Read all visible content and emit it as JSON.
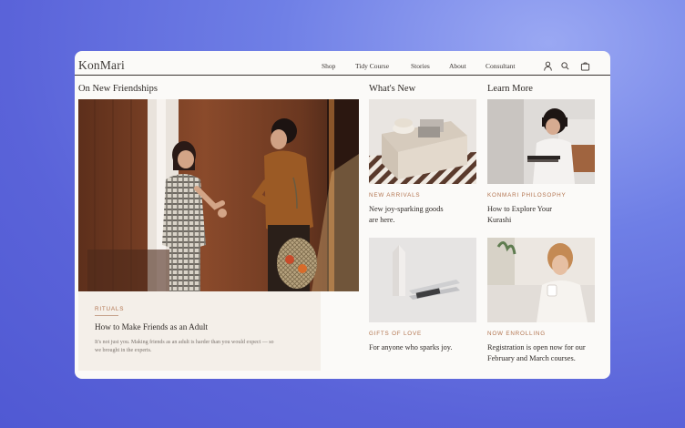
{
  "brand": {
    "logo": "KonMari"
  },
  "nav": {
    "items": [
      "Shop",
      "Tidy Course",
      "Stories",
      "About",
      "Consultant"
    ],
    "icons": [
      "account-icon",
      "search-icon",
      "cart-icon"
    ]
  },
  "featured": {
    "section_title": "On New Friendships",
    "eyebrow": "RITUALS",
    "headline": "How to Make Friends as an Adult",
    "excerpt_line1": "It's not just you. Making friends as an adult is harder than you would expect — so",
    "excerpt_line2": "we brought in the experts."
  },
  "whats_new": {
    "section_title": "What's New",
    "cards": [
      {
        "eyebrow": "NEW ARRIVALS",
        "text_line1": "New joy-sparking goods",
        "text_line2": "are here."
      },
      {
        "eyebrow": "GIFTS OF LOVE",
        "text_line1": "For anyone who sparks joy.",
        "text_line2": ""
      }
    ]
  },
  "learn_more": {
    "section_title": "Learn More",
    "cards": [
      {
        "eyebrow": "KONMARI PHILOSOPHY",
        "text_line1": "How to Explore Your",
        "text_line2": "Kurashi"
      },
      {
        "eyebrow": "NOW ENROLLING",
        "text_line1": "Registration is open now for our",
        "text_line2": "February and March courses."
      }
    ]
  },
  "colors": {
    "accent": "#b2744f",
    "card_bg": "#fbfaf8",
    "overlay_bg": "#f4efe9",
    "background": "#5a63d9"
  }
}
